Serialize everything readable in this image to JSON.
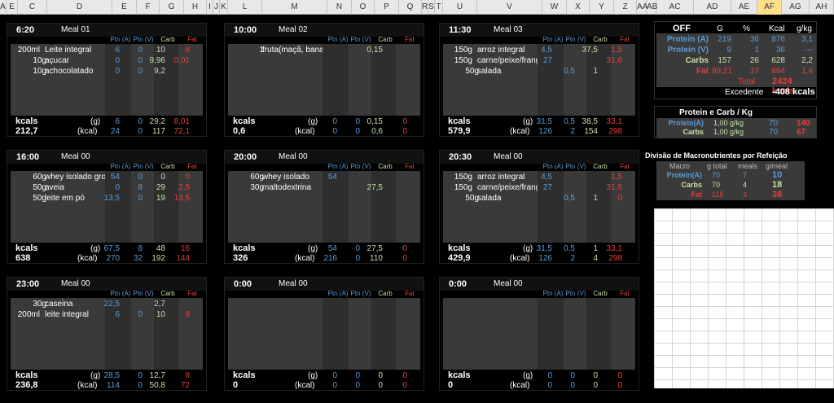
{
  "columns": [
    "A",
    "E",
    "C",
    "D",
    "E",
    "F",
    "G",
    "H",
    "I",
    "J",
    "K",
    "L",
    "M",
    "N",
    "O",
    "P",
    "Q",
    "R",
    "S",
    "T",
    "U",
    "V",
    "W",
    "X",
    "Y",
    "Z",
    "AA",
    "AB",
    "AC",
    "AD",
    "AE",
    "AF",
    "AG",
    "AH"
  ],
  "col_heads": {
    "ptn_a": "Ptn (A)",
    "ptn_v": "Ptn (V)",
    "carb": "Carb",
    "fat": "Fat"
  },
  "labels": {
    "kcals": "kcals",
    "g": "(g)",
    "kcal": "(kcal)"
  },
  "meals": [
    {
      "time": "6:20",
      "name": "Meal 01",
      "items": [
        [
          "200ml",
          "Leite integral",
          "6",
          "0",
          "10",
          "8"
        ],
        [
          "10g",
          "açucar",
          "0",
          "0",
          "9,96",
          "0,01"
        ],
        [
          "10g",
          "achocolatado",
          "0",
          "0",
          "9,2",
          ""
        ]
      ],
      "g": [
        "6",
        "0",
        "29,2",
        "8,01"
      ],
      "kcal": [
        "24",
        "0",
        "117",
        "72,1"
      ],
      "total": "212,7"
    },
    {
      "time": "10:00",
      "name": "Meal 02",
      "items": [
        [
          "1",
          "fruta(maçã, banana)",
          "",
          "",
          "0,15",
          ""
        ]
      ],
      "g": [
        "0",
        "0",
        "0,15",
        "0"
      ],
      "kcal": [
        "0",
        "0",
        "0,6",
        "0"
      ],
      "total": "0,6"
    },
    {
      "time": "11:30",
      "name": "Meal 03",
      "items": [
        [
          "150g",
          "arroz integral",
          "4,5",
          "",
          "37,5",
          "1,5"
        ],
        [
          "150g",
          "carne/peixe/frango",
          "27",
          "",
          "",
          "31,6"
        ],
        [
          "50g",
          "salada",
          "",
          "0,5",
          "1",
          ""
        ]
      ],
      "g": [
        "31,5",
        "0,5",
        "38,5",
        "33,1"
      ],
      "kcal": [
        "126",
        "2",
        "154",
        "298"
      ],
      "total": "579,9"
    },
    {
      "time": "16:00",
      "name": "Meal 00",
      "items": [
        [
          "60g",
          "whey isolado grow",
          "54",
          "0",
          "0",
          "0"
        ],
        [
          "50g",
          "aveia",
          "0",
          "8",
          "29",
          "2,5"
        ],
        [
          "50g",
          "leite em pó",
          "13,5",
          "0",
          "19",
          "13,5"
        ]
      ],
      "g": [
        "67,5",
        "8",
        "48",
        "16"
      ],
      "kcal": [
        "270",
        "32",
        "192",
        "144"
      ],
      "total": "638"
    },
    {
      "time": "20:00",
      "name": "Meal 00",
      "items": [
        [
          "60g",
          "whey isolado",
          "54",
          "",
          "",
          ""
        ],
        [
          "30g",
          "maltodextrina",
          "",
          "",
          "27,5",
          ""
        ]
      ],
      "g": [
        "54",
        "0",
        "27,5",
        "0"
      ],
      "kcal": [
        "216",
        "0",
        "110",
        "0"
      ],
      "total": "326"
    },
    {
      "time": "20:30",
      "name": "Meal 00",
      "items": [
        [
          "150g",
          "arroz integral",
          "4,5",
          "",
          "",
          "1,5"
        ],
        [
          "150g",
          "carne/peixe/frango",
          "27",
          "",
          "",
          "31,6"
        ],
        [
          "50g",
          "salada",
          "",
          "0,5",
          "1",
          "0"
        ]
      ],
      "g": [
        "31,5",
        "0,5",
        "1",
        "33,1"
      ],
      "kcal": [
        "126",
        "2",
        "4",
        "298"
      ],
      "total": "429,9"
    },
    {
      "time": "23:00",
      "name": "Meal 00",
      "items": [
        [
          "30g",
          "caseina",
          "22,5",
          "",
          "2,7",
          ""
        ],
        [
          "200ml",
          "leite integral",
          "6",
          "0",
          "10",
          "8"
        ]
      ],
      "g": [
        "28,5",
        "0",
        "12,7",
        "8"
      ],
      "kcal": [
        "114",
        "0",
        "50,8",
        "72"
      ],
      "total": "236,8"
    },
    {
      "time": "0:00",
      "name": "Meal 00",
      "items": [],
      "g": [
        "0",
        "0",
        "0",
        "0"
      ],
      "kcal": [
        "0",
        "0",
        "0",
        "0"
      ],
      "total": "0"
    },
    {
      "time": "0:00",
      "name": "Meal 00",
      "items": [],
      "g": [
        "0",
        "0",
        "0",
        "0"
      ],
      "kcal": [
        "0",
        "0",
        "0",
        "0"
      ],
      "total": "0"
    }
  ],
  "summary": {
    "title": "OFF",
    "heads": [
      "G",
      "%",
      "Kcal",
      "g/kg"
    ],
    "rows": [
      [
        "Protein (A)",
        "219",
        "36",
        "876",
        "3,1"
      ],
      [
        "Protein (V)",
        "9",
        "1",
        "36",
        "---"
      ],
      [
        "Carbs",
        "157",
        "26",
        "628",
        "2,2"
      ],
      [
        "Fat",
        "99,21",
        "37",
        "894",
        "1,4"
      ]
    ],
    "total_label": "Total",
    "total_value": "2424 kcals",
    "exc_label": "Excedente",
    "exc_value": "-408 kcals"
  },
  "pcg": {
    "title": "Protein e Carb / Kg",
    "rows": [
      [
        "Protein(A)",
        "1,00 g/kg",
        "70",
        "140"
      ],
      [
        "Carbs",
        "1,00 g/kg",
        "70",
        "67"
      ]
    ]
  },
  "div": {
    "title": "Divisão de Macronutrientes por Refeição",
    "heads": [
      "Macro",
      "g total",
      "meals",
      "g/meal"
    ],
    "rows": [
      [
        "Protein(A)",
        "70",
        "7",
        "10"
      ],
      [
        "Carbs",
        "70",
        "4",
        "18"
      ],
      [
        "Fat",
        "115",
        "3",
        "38"
      ]
    ]
  },
  "colors": {
    "blue": "#5b9bd5",
    "green": "#c5e0a5",
    "red": "#e0413a",
    "panel_gray": "#3a3a3a"
  }
}
